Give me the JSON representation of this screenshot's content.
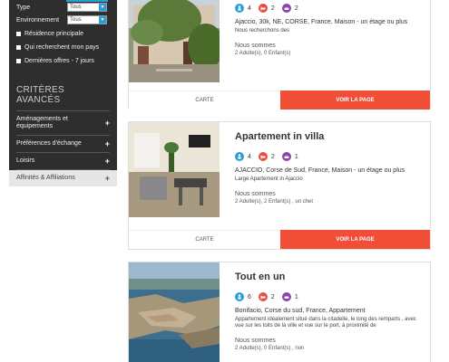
{
  "sidebar": {
    "filters": [
      {
        "label": "Type",
        "value": "Tous"
      },
      {
        "label": "Environnement",
        "value": "Tous"
      }
    ],
    "checkboxes": [
      "Résidence principale",
      "Qui recherchent mon pays",
      "Dernières offres - 7 jours"
    ],
    "advanced_title": "CRITÈRES AVANCÉS",
    "advanced_items": [
      "Aménagements et équipements",
      "Préférences d'échange",
      "Loisirs",
      "Affinités & Affiliations"
    ]
  },
  "listings": [
    {
      "title": "",
      "stats": {
        "persons": "4",
        "beds": "2",
        "baths": "2"
      },
      "location": "Ajaccio, 30k, NE, CORSE, France, Maison - un étage ou plus",
      "description": "Nous recherchons des",
      "nous_label": "Nous sommes",
      "adults": "2 Adulte(s), 0 Enfant(s)",
      "map_label": "CARTE",
      "cta_label": "VOIR LA PAGE"
    },
    {
      "title": "Apartement in villa",
      "stats": {
        "persons": "4",
        "beds": "2",
        "baths": "1"
      },
      "location": "AJACCIO, Corse de Sud, France, Maison - un étage ou plus",
      "description": "Large Apartement in Ajaccio",
      "nous_label": "Nous sommes",
      "adults": "2 Adulte(s), 2 Enfant(s) , un chet",
      "map_label": "CARTE",
      "cta_label": "VOIR LA PAGE"
    },
    {
      "title": "Tout en un",
      "stats": {
        "persons": "6",
        "beds": "2",
        "baths": "1"
      },
      "location": "Bonifacio, Corse du sud, France, Appartement",
      "description": "Appartement idéalement situé dans la citadelle, le long des remparts , avec vue sur les toits de la ville et vue sur le port, à proximité de",
      "nous_label": "Nous sommes",
      "adults": "2 Adulte(s), 0 Enfant(s) , non",
      "map_label": "CARTE",
      "cta_label": "VOIR LA PAGE"
    }
  ],
  "colors": {
    "sidebar_bg": "#2e2e2e",
    "accent_blue": "#2a9fd6",
    "cta_red": "#f04e37",
    "persons_dot": "#2a9fd6",
    "beds_dot": "#e74c3c",
    "baths_dot": "#8e44ad"
  },
  "icons": {
    "persons": "person-icon",
    "beds": "bed-icon",
    "baths": "bath-icon",
    "expand": "plus-icon",
    "dropdown": "chevron-down-icon"
  }
}
